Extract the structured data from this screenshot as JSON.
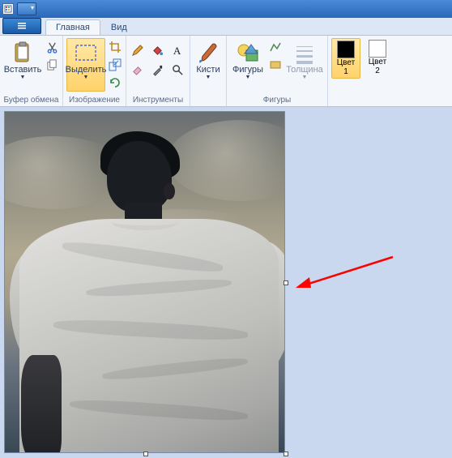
{
  "tabs": {
    "main": "Главная",
    "view": "Вид"
  },
  "groups": {
    "clipboard": {
      "label": "Буфер обмена",
      "paste": "Вставить"
    },
    "image": {
      "label": "Изображение",
      "select": "Выделить"
    },
    "tools": {
      "label": "Инструменты"
    },
    "brushes": {
      "label": "Кисти",
      "btn": "Кисти"
    },
    "shapes": {
      "label": "Фигуры",
      "btn": "Фигуры",
      "thickness": "Толщина"
    },
    "colors": {
      "color1": "Цвет\n1",
      "color2": "Цвет\n2"
    }
  },
  "colors": {
    "c1": "#000000",
    "c2": "#ffffff"
  },
  "annotation": {
    "arrow_color": "#ff0000"
  }
}
